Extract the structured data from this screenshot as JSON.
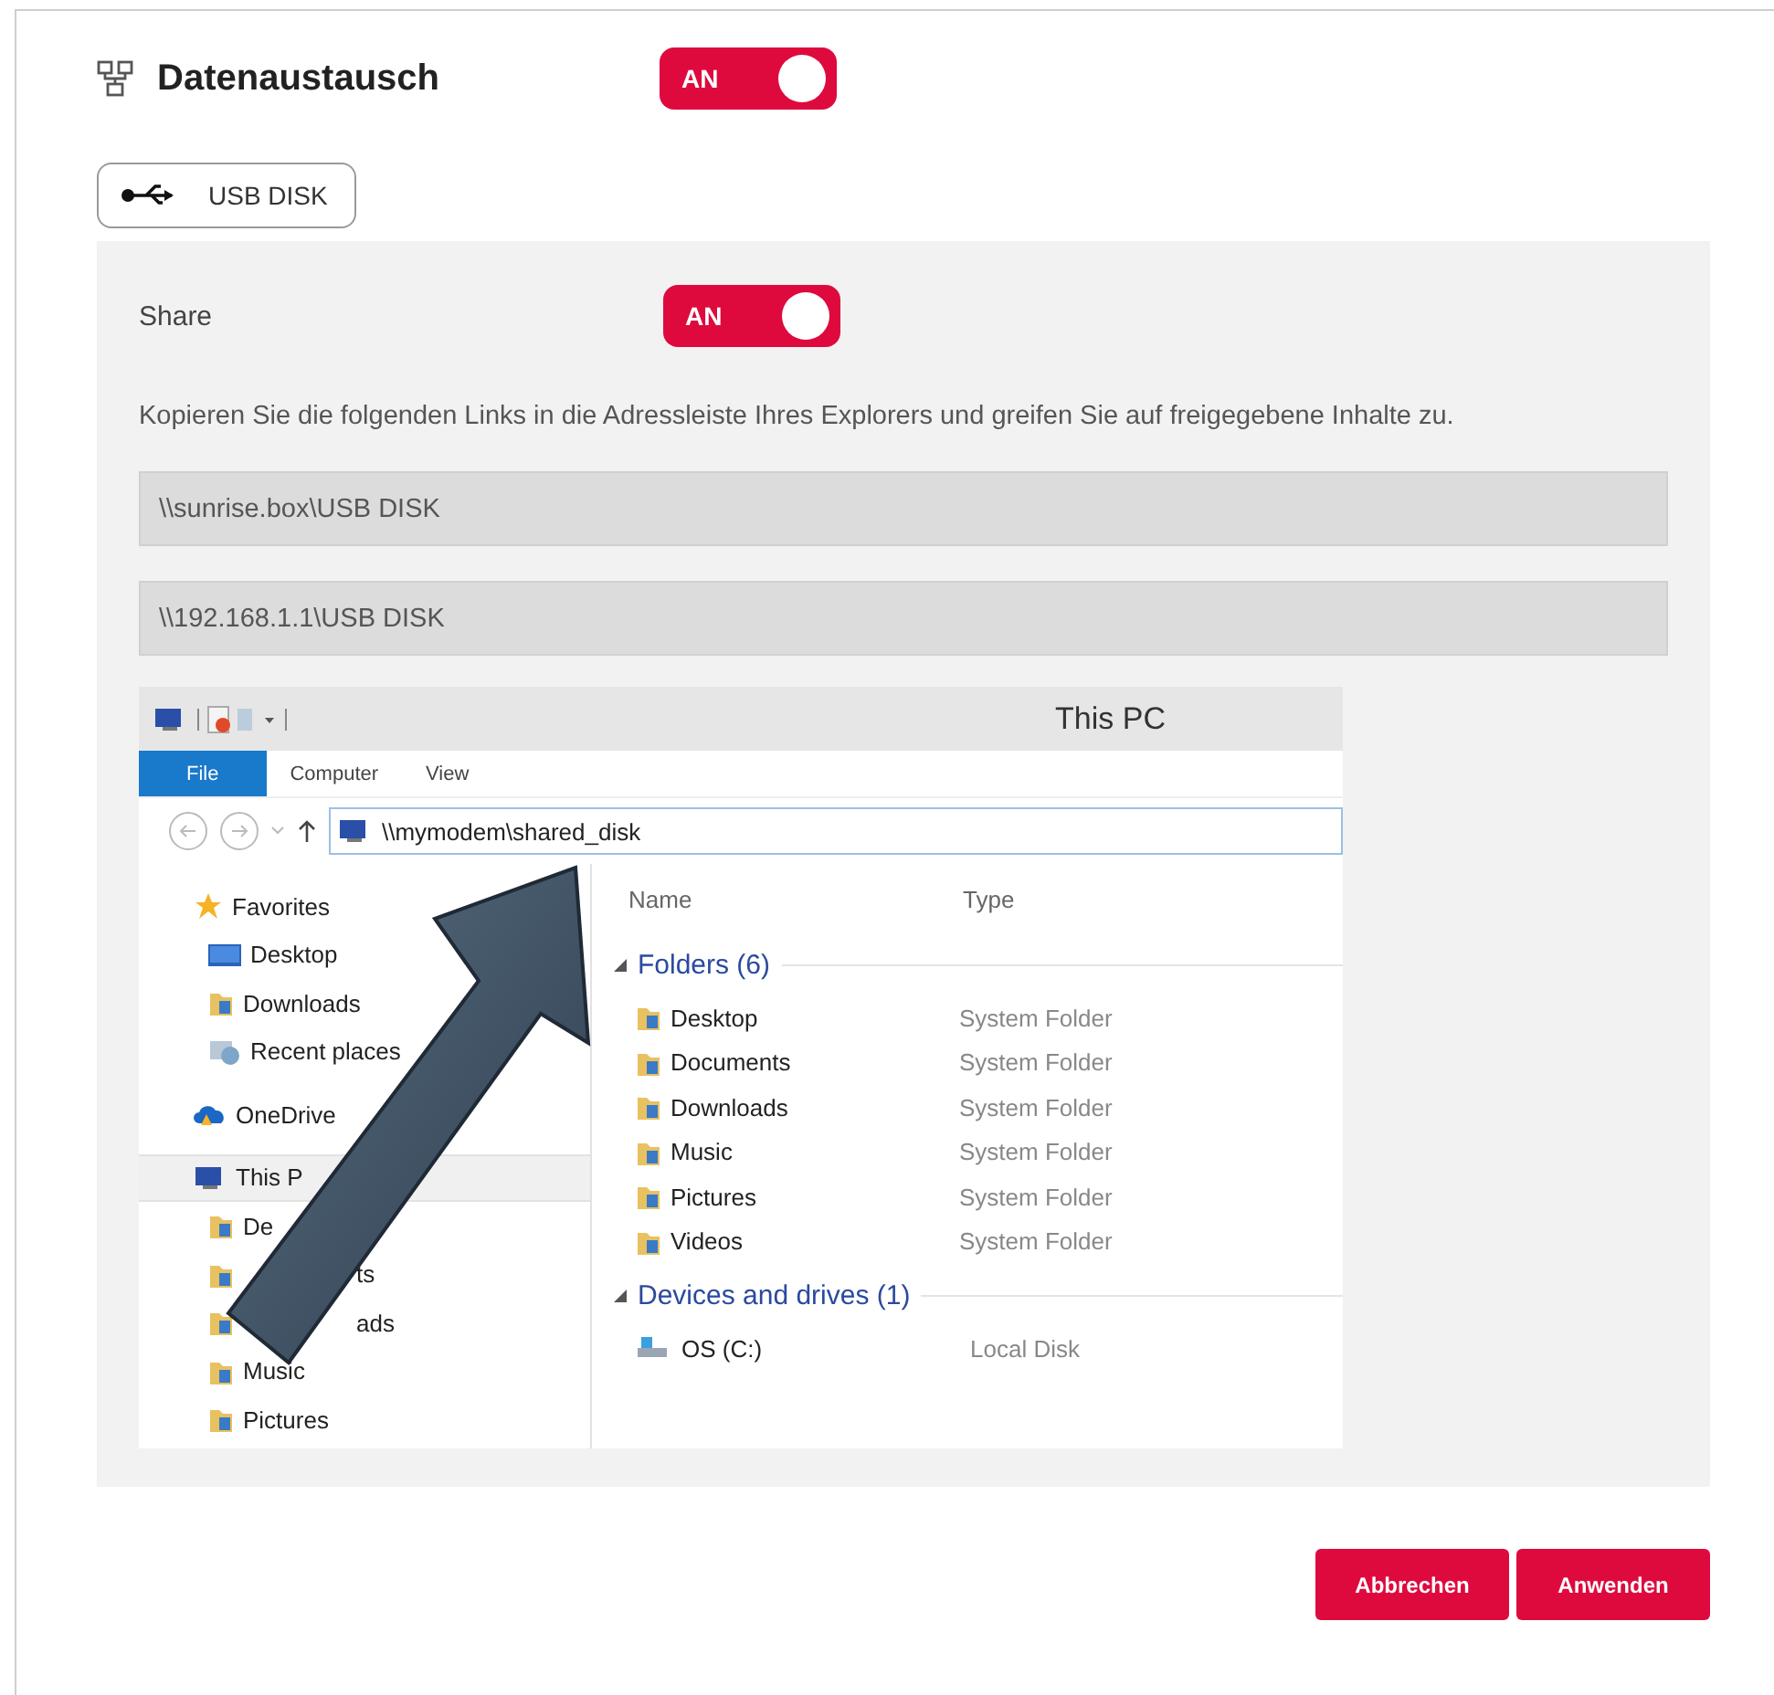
{
  "header": {
    "title": "Datenaustausch",
    "toggle": {
      "label": "AN",
      "on": true
    }
  },
  "device_tabs": [
    {
      "label": "USB DISK",
      "selected": true
    }
  ],
  "share": {
    "label": "Share",
    "toggle": {
      "label": "AN",
      "on": true
    }
  },
  "description": "Kopieren Sie die folgenden Links in die Adressleiste Ihres Explorers und greifen Sie auf freigegebene Inhalte zu.",
  "links": [
    "\\\\sunrise.box\\USB DISK",
    "\\\\192.168.1.1\\USB DISK"
  ],
  "explorer": {
    "title": "This PC",
    "ribbon_tabs": [
      {
        "label": "File",
        "selected": true
      },
      {
        "label": "Computer",
        "selected": false
      },
      {
        "label": "View",
        "selected": false
      }
    ],
    "address": "\\\\mymodem\\shared_disk",
    "nav": [
      {
        "label": "Favorites",
        "kind": "star",
        "selected": false,
        "covered": false,
        "children": [
          {
            "label": "Desktop",
            "kind": "desktop",
            "selected": false,
            "covered": false
          },
          {
            "label": "Downloads",
            "kind": "folder",
            "selected": false,
            "covered": false
          },
          {
            "label": "Recent places",
            "kind": "recent",
            "selected": false,
            "covered": false
          }
        ]
      },
      {
        "label": "OneDrive",
        "kind": "cloud",
        "selected": false,
        "covered": false
      },
      {
        "label": "This P",
        "kind": "pc",
        "selected": true,
        "covered": false,
        "children": [
          {
            "label": "De",
            "kind": "folder",
            "selected": false,
            "covered": false
          },
          {
            "label": "ts",
            "kind": "folder",
            "selected": false,
            "covered": true
          },
          {
            "label": "ads",
            "kind": "folder",
            "selected": false,
            "covered": true
          },
          {
            "label": "Music",
            "kind": "folder",
            "selected": false,
            "covered": false
          },
          {
            "label": "Pictures",
            "kind": "folder",
            "selected": false,
            "covered": false
          }
        ]
      }
    ],
    "columns": [
      "Name",
      "Type"
    ],
    "groups": [
      {
        "title": "Folders (6)",
        "items": [
          {
            "name": "Desktop",
            "type": "System Folder",
            "kind": "folder"
          },
          {
            "name": "Documents",
            "type": "System Folder",
            "kind": "folder"
          },
          {
            "name": "Downloads",
            "type": "System Folder",
            "kind": "folder"
          },
          {
            "name": "Music",
            "type": "System Folder",
            "kind": "folder"
          },
          {
            "name": "Pictures",
            "type": "System Folder",
            "kind": "folder"
          },
          {
            "name": "Videos",
            "type": "System Folder",
            "kind": "folder"
          }
        ]
      },
      {
        "title": "Devices and drives (1)",
        "items": [
          {
            "name": "OS (C:)",
            "type": "Local Disk",
            "kind": "drive"
          }
        ]
      }
    ]
  },
  "buttons": [
    "Abbrechen",
    "Anwenden"
  ]
}
